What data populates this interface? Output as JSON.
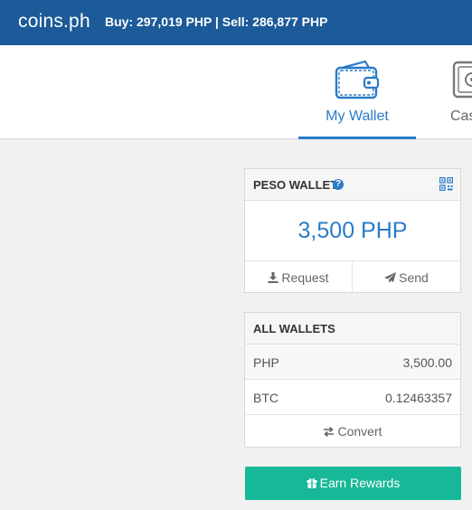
{
  "header": {
    "brand": "coins.ph",
    "rates": "Buy: 297,019 PHP | Sell: 286,877 PHP"
  },
  "nav": {
    "tabs": [
      {
        "label": "My Wallet",
        "icon": "wallet-icon",
        "active": true
      },
      {
        "label": "Cas",
        "icon": "safe-icon",
        "active": false
      }
    ]
  },
  "peso_wallet": {
    "title": "PESO WALLET",
    "balance": "3,500 PHP",
    "request_label": "Request",
    "send_label": "Send"
  },
  "all_wallets": {
    "title": "ALL WALLETS",
    "rows": [
      {
        "currency": "PHP",
        "amount": "3,500.00"
      },
      {
        "currency": "BTC",
        "amount": "0.12463357"
      }
    ],
    "convert_label": "Convert"
  },
  "rewards": {
    "label": "Earn Rewards"
  },
  "colors": {
    "header_bg": "#1c5a99",
    "accent": "#2a7bc8",
    "rewards_bg": "#17b897"
  }
}
